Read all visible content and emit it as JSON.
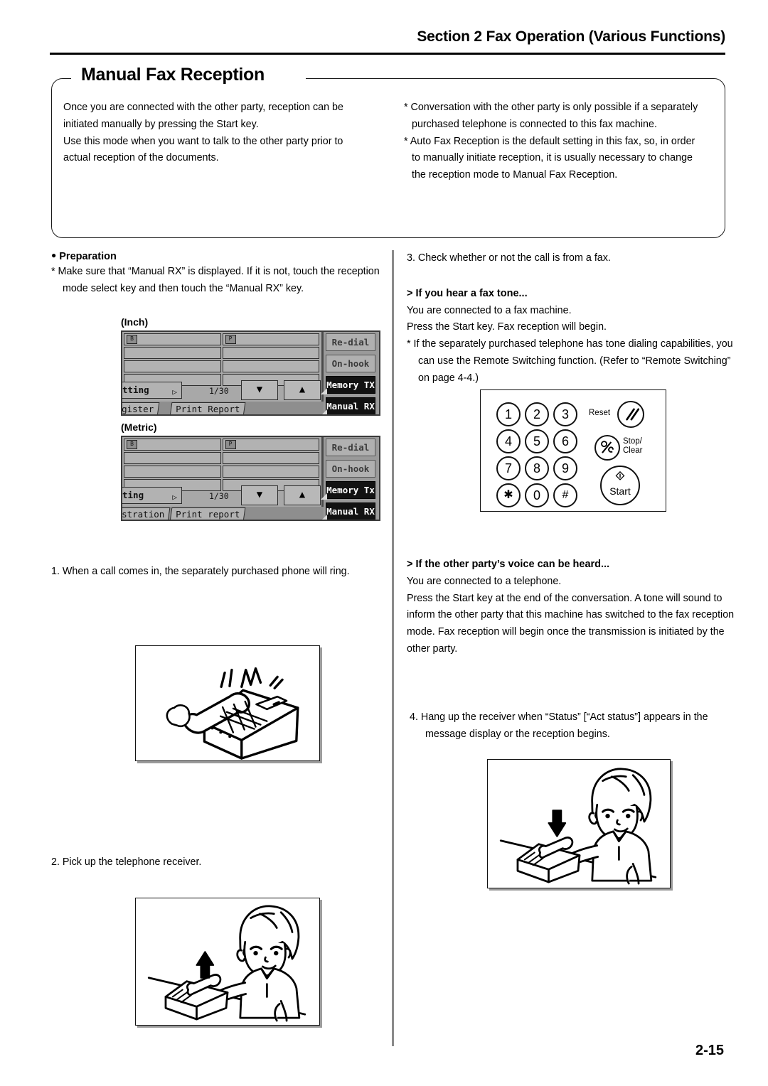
{
  "header": {
    "section_title": "Section 2  Fax Operation (Various Functions)"
  },
  "intro": {
    "title": "Manual Fax Reception",
    "left_lines": [
      "Once you are connected with the other party, reception can be",
      "initiated manually by pressing the Start key.",
      "Use this mode when you want to talk to the other party prior to",
      "actual reception of the documents."
    ],
    "right_lines": [
      "* Conversation with the other party is only possible if a separately",
      "purchased telephone is connected to this fax machine.",
      "* Auto Fax Reception is the default setting in this fax, so, in order",
      "to manually initiate reception, it is usually necessary to change",
      "the reception mode to Manual Fax Reception."
    ]
  },
  "left_column": {
    "preparation_heading": "Preparation",
    "preparation_note": "* Make sure that “Manual RX” is displayed. If it is not, touch the reception mode select key and then touch the “Manual RX” key.",
    "panels": [
      {
        "caption": "(Inch)",
        "setting_key": "tting",
        "page_count": "1/30",
        "tab_left": "gister",
        "tab_right": "Print Report",
        "soft_keys": [
          "Re-dial",
          "On-hook",
          "Memory TX",
          "Manual RX"
        ],
        "cell_tag_left": "B",
        "cell_tag_right": "P",
        "arrow_down": "▼",
        "arrow_up": "▲"
      },
      {
        "caption": "(Metric)",
        "setting_key": "ting",
        "page_count": "1/30",
        "tab_left": "stration",
        "tab_right": "Print report",
        "soft_keys": [
          "Re-dial",
          "On-hook",
          "Memory Tx",
          "Manual RX"
        ],
        "cell_tag_left": "B",
        "cell_tag_right": "P",
        "arrow_down": "▼",
        "arrow_up": "▲"
      }
    ],
    "step1": "1. When a call comes in, the separately purchased phone will ring.",
    "step1_figure_alt": "Ringing desktop telephone with sound waves",
    "step2": "2. Pick up the telephone receiver.",
    "step2_figure_alt": "Person lifting the telephone receiver, upward arrow"
  },
  "right_column": {
    "step3": "3. Check whether or not the call is from a fax.",
    "fax_tone_heading": "> If you hear a fax tone...",
    "fax_tone_lines": [
      "You are connected to a fax machine.",
      "Press the Start key. Fax reception will begin."
    ],
    "fax_tone_note": "* If the separately purchased telephone has tone dialing capabilities, you can use the Remote Switching function. (Refer to “Remote Switching” on page 4-4.)",
    "keypad": {
      "keys": [
        "1",
        "2",
        "3",
        "4",
        "5",
        "6",
        "7",
        "8",
        "9",
        "✱",
        "0",
        "#"
      ],
      "reset_label": "Reset",
      "reset_icon": "double-slash-icon",
      "stop_label_line1": "Stop/",
      "stop_label_line2": "Clear",
      "stop_icon": "percent-c-icon",
      "start_label": "Start",
      "start_icon": "diamond-icon"
    },
    "voice_heading": "> If the other party’s voice can be heard...",
    "voice_lines": [
      "You are connected to a telephone.",
      "Press the Start key at the end of the conversation. A tone will sound to inform the other party that this machine has switched to the fax reception mode. Fax reception will begin once the transmission is initiated by the other party."
    ],
    "step4": "4. Hang up the receiver when “Status” [“Act status”] appears in the message display or the reception begins.",
    "step4_figure_alt": "Person hanging up the telephone receiver, downward arrow"
  },
  "footer": {
    "page_number": "2-15"
  }
}
